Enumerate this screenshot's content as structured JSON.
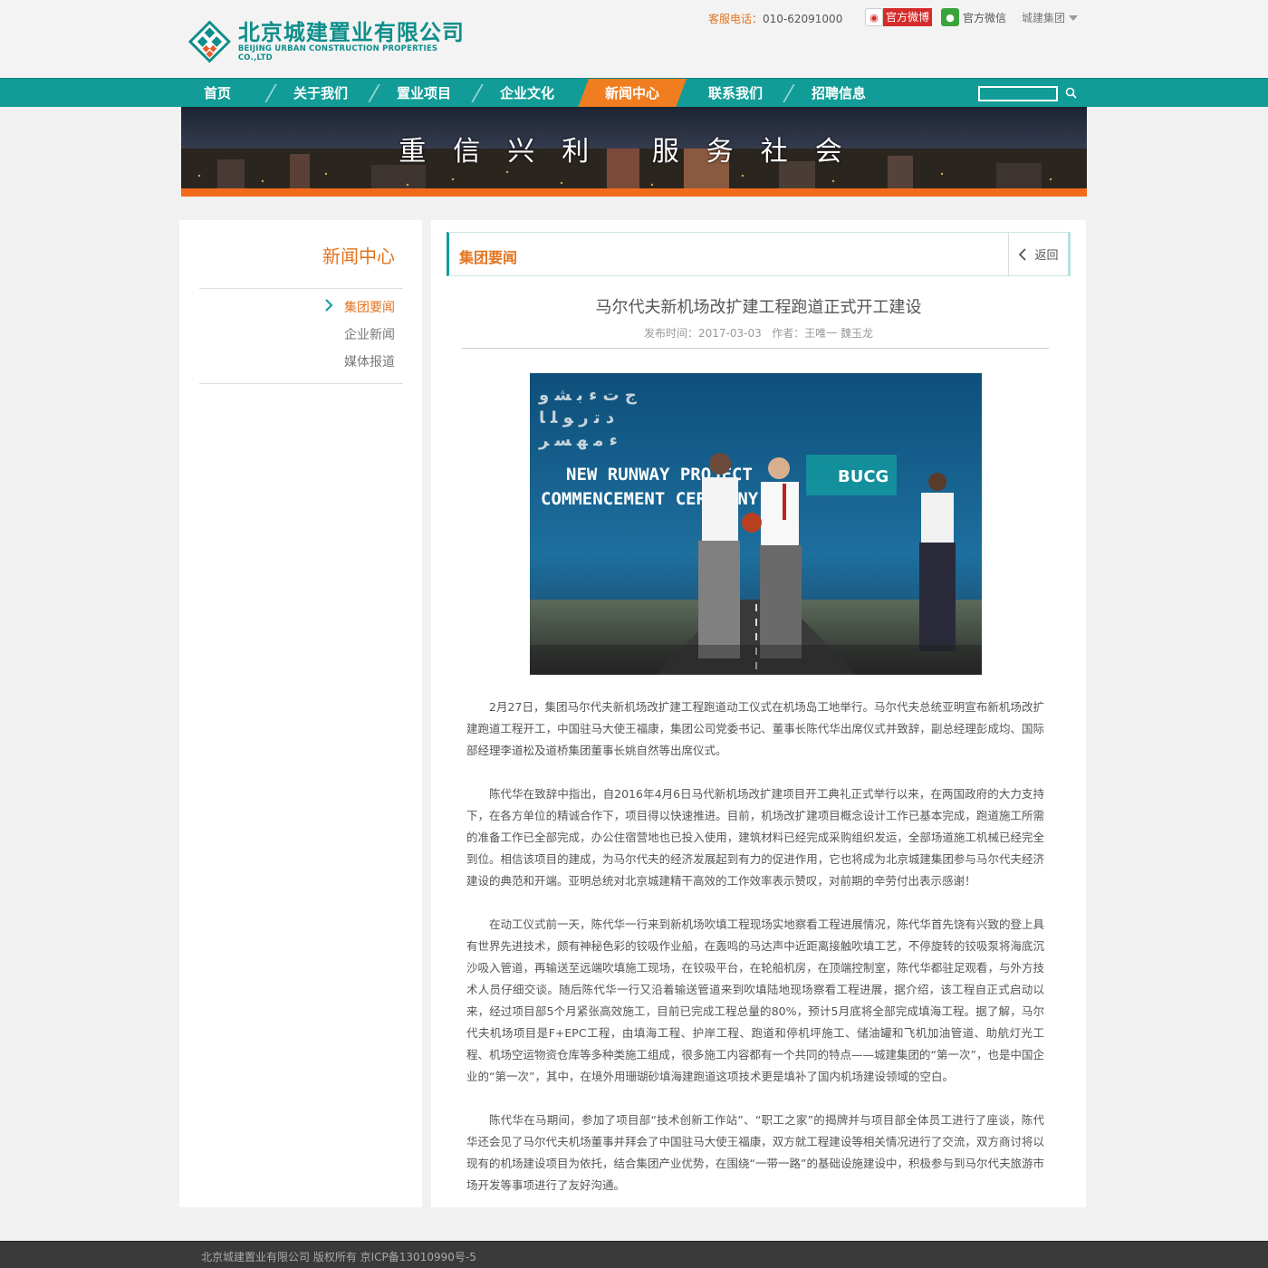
{
  "header": {
    "logo_cn": "北京城建置业有限公司",
    "logo_en": "BEIJING URBAN CONSTRUCTION PROPERTIES CO.,LTD",
    "hotline_label": "客服电话：",
    "hotline_number": "010-62091000",
    "weibo_label": "官方微博",
    "wechat_label": "官方微信",
    "group_label": "城建集团"
  },
  "nav": {
    "items": [
      {
        "label": "首页"
      },
      {
        "label": "关于我们"
      },
      {
        "label": "置业项目"
      },
      {
        "label": "企业文化"
      },
      {
        "label": "新闻中心"
      },
      {
        "label": "联系我们"
      },
      {
        "label": "招聘信息"
      }
    ],
    "active_index": 4,
    "search_placeholder": ""
  },
  "banner": {
    "slogan": "重信兴利 服务社会"
  },
  "sidebar": {
    "title": "新闻中心",
    "items": [
      {
        "label": "集团要闻",
        "active": true
      },
      {
        "label": "企业新闻",
        "active": false
      },
      {
        "label": "媒体报道",
        "active": false
      }
    ]
  },
  "main": {
    "section_title": "集团要闻",
    "back_label": "返回",
    "article_title": "马尔代夫新机场改扩建工程跑道正式开工建设",
    "meta_date_label": "发布时间：",
    "meta_date": "2017-03-03",
    "meta_author_label": "作者：",
    "meta_author": "王唯一 魏玉龙",
    "photo": {
      "banner_line1": "NEW RUNWAY PROJECT",
      "banner_line2": "COMMENCEMENT CEREMONY",
      "brand": "BUCG"
    },
    "paragraphs": [
      "2月27日，集团马尔代夫新机场改扩建工程跑道动工仪式在机场岛工地举行。马尔代夫总统亚明宣布新机场改扩建跑道工程开工，中国驻马大使王福康，集团公司党委书记、董事长陈代华出席仪式并致辞，副总经理彭成均、国际部经理李道松及道桥集团董事长姚自然等出席仪式。",
      "陈代华在致辞中指出，自2016年4月6日马代新机场改扩建项目开工典礼正式举行以来，在两国政府的大力支持下，在各方单位的精诚合作下，项目得以快速推进。目前，机场改扩建项目概念设计工作已基本完成，跑道施工所需的准备工作已全部完成，办公住宿营地也已投入使用，建筑材料已经完成采购组织发运，全部场道施工机械已经完全到位。相信该项目的建成，为马尔代夫的经济发展起到有力的促进作用，它也将成为北京城建集团参与马尔代夫经济建设的典范和开端。亚明总统对北京城建精干高效的工作效率表示赞叹，对前期的辛劳付出表示感谢！",
      "在动工仪式前一天，陈代华一行来到新机场吹填工程现场实地察看工程进展情况，陈代华首先饶有兴致的登上具有世界先进技术，颇有神秘色彩的铰吸作业船，在轰鸣的马达声中近距离接触吹填工艺，不停旋转的铰吸泵将海底沉沙吸入管道，再输送至远端吹填施工现场，在铰吸平台，在轮船机房，在顶端控制室，陈代华都驻足观看，与外方技术人员仔细交谈。随后陈代华一行又沿着输送管道来到吹填陆地现场察看工程进展，据介绍，该工程自正式启动以来，经过项目部5个月紧张高效施工，目前已完成工程总量的80%，预计5月底将全部完成填海工程。据了解，马尔代夫机场项目是F+EPC工程，由填海工程、护岸工程、跑道和停机坪施工、储油罐和飞机加油管道、助航灯光工程、机场空运物资仓库等多种类施工组成，很多施工内容都有一个共同的特点——城建集团的“第一次”，也是中国企业的“第一次”，其中，在境外用珊瑚砂填海建跑道这项技术更是填补了国内机场建设领域的空白。",
      "陈代华在马期间，参加了项目部“技术创新工作站”、“职工之家”的揭牌并与项目部全体员工进行了座谈，陈代华还会见了马尔代夫机场董事并拜会了中国驻马大使王福康，双方就工程建设等相关情况进行了交流，双方商讨将以现有的机场建设项目为依托，结合集团产业优势，在围绕“一带一路”的基础设施建设中，积极参与到马尔代夫旅游市场开发等事项进行了友好沟通。"
    ]
  },
  "footer": {
    "text": "北京城建置业有限公司 版权所有  京ICP备13010990号-5"
  },
  "colors": {
    "teal": "#119c97",
    "orange": "#f07d1f",
    "text_orange": "#e3731e"
  }
}
